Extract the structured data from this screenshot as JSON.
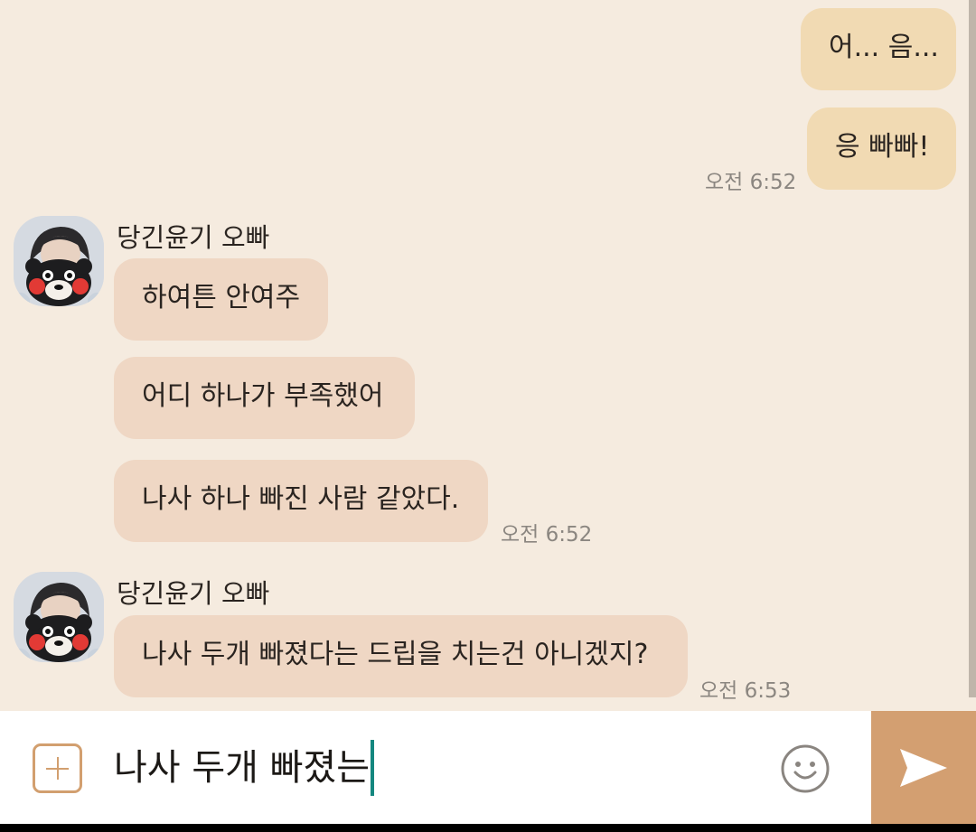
{
  "colors": {
    "background": "#f5ebdf",
    "outgoing_bubble": "#f1dab3",
    "incoming_bubble": "#efd7c4",
    "accent": "#d39f71",
    "caret": "#14877f"
  },
  "messages": [
    {
      "direction": "outgoing",
      "text": "어... 음..."
    },
    {
      "direction": "outgoing",
      "text": "응 빠빠!",
      "time": "오전 6:52"
    },
    {
      "direction": "incoming",
      "sender": "당긴윤기 오빠",
      "text": "하여튼 안여주"
    },
    {
      "direction": "incoming",
      "text": "어디 하나가 부족했어"
    },
    {
      "direction": "incoming",
      "text": "나사 하나 빠진 사람 같았다.",
      "time": "오전 6:52"
    },
    {
      "direction": "incoming",
      "sender": "당긴윤기 오빠",
      "text": "나사 두개 빠졌다는 드립을 치는건 아니겠지?",
      "time": "오전 6:53"
    }
  ],
  "composer": {
    "add_icon": "plus-square-icon",
    "input_value": "나사 두개 빠졌는",
    "emoji_icon": "smiley-icon",
    "send_icon": "paper-plane-icon"
  }
}
